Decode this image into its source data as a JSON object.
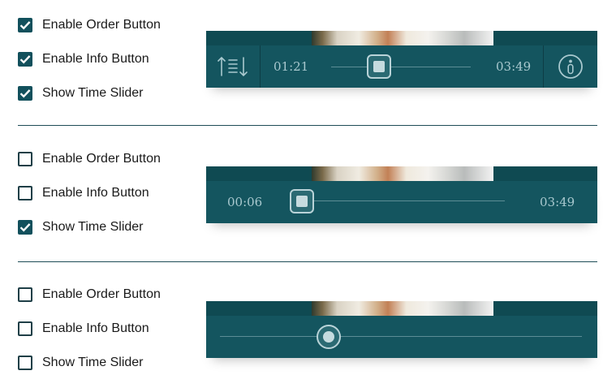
{
  "colors": {
    "accent": "#12505c",
    "player_bar": "#14555f",
    "thumb_strip": "#0f4a52",
    "time_text": "#a9c9cf"
  },
  "configs": [
    {
      "options": [
        {
          "label": "Enable Order Button",
          "checked": true
        },
        {
          "label": "Enable Info Button",
          "checked": true
        },
        {
          "label": "Show Time Slider",
          "checked": true
        }
      ],
      "player": {
        "time_current": "01:21",
        "time_total": "03:49",
        "order_icon": "order-sort-icon",
        "info_icon": "info-icon"
      }
    },
    {
      "options": [
        {
          "label": "Enable Order Button",
          "checked": false
        },
        {
          "label": "Enable Info Button",
          "checked": false
        },
        {
          "label": "Show Time Slider",
          "checked": true
        }
      ],
      "player": {
        "time_current": "00:06",
        "time_total": "03:49"
      }
    },
    {
      "options": [
        {
          "label": "Enable Order Button",
          "checked": false
        },
        {
          "label": "Enable Info Button",
          "checked": false
        },
        {
          "label": "Show Time Slider",
          "checked": false
        }
      ],
      "player": {}
    }
  ]
}
